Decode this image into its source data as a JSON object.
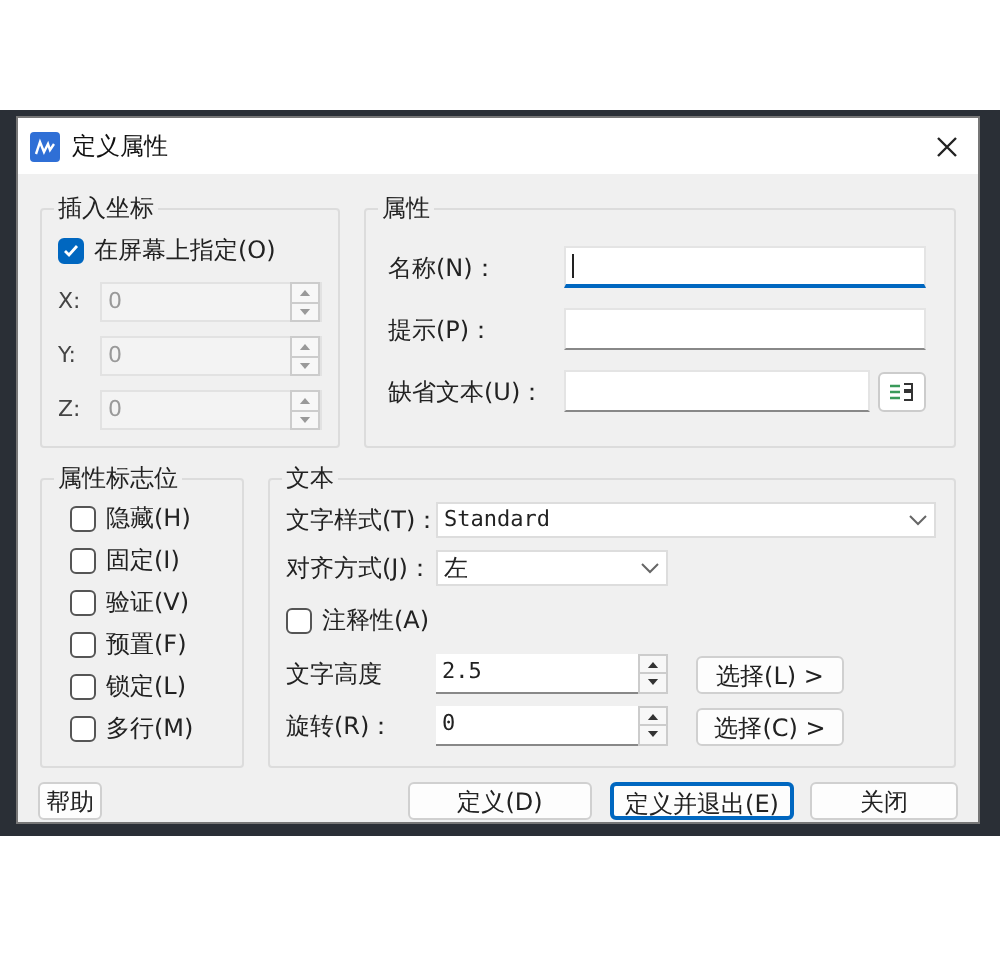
{
  "window": {
    "title": "定义属性"
  },
  "insert_point": {
    "title": "插入坐标",
    "on_screen": {
      "label": "在屏幕上指定(O)",
      "checked": true
    },
    "coords": [
      {
        "label": "X:",
        "value": "0",
        "disabled": true
      },
      {
        "label": "Y:",
        "value": "0",
        "disabled": true
      },
      {
        "label": "Z:",
        "value": "0",
        "disabled": true
      }
    ]
  },
  "attribute": {
    "title": "属性",
    "fields": [
      {
        "label": "名称(N)：",
        "focused": true,
        "kind": "plain"
      },
      {
        "label": "提示(P)：",
        "focused": false,
        "kind": "plain"
      },
      {
        "label": "缺省文本(U)：",
        "focused": false,
        "kind": "field-button"
      }
    ]
  },
  "flags": {
    "title": "属性标志位",
    "items": [
      {
        "label": "隐藏(H)",
        "checked": false
      },
      {
        "label": "固定(I)",
        "checked": false
      },
      {
        "label": "验证(V)",
        "checked": false
      },
      {
        "label": "预置(F)",
        "checked": false
      },
      {
        "label": "锁定(L)",
        "checked": false
      },
      {
        "label": "多行(M)",
        "checked": false
      }
    ]
  },
  "text": {
    "title": "文本",
    "style": {
      "label": "文字样式(T)：",
      "value": "Standard"
    },
    "justification": {
      "label": "对齐方式(J)：",
      "value": "左"
    },
    "annotative": {
      "label": "注释性(A)",
      "checked": false
    },
    "height": {
      "label": "文字高度",
      "value": "2.5",
      "button": "选择(L) >"
    },
    "rotation": {
      "label": "旋转(R)：",
      "value": "0",
      "button": "选择(C) >"
    }
  },
  "buttons": [
    {
      "label": "帮助",
      "default": false
    },
    {
      "label": "定义(D)",
      "default": false
    },
    {
      "label": "定义并退出(E)",
      "default": true
    },
    {
      "label": "关闭",
      "default": false
    }
  ]
}
